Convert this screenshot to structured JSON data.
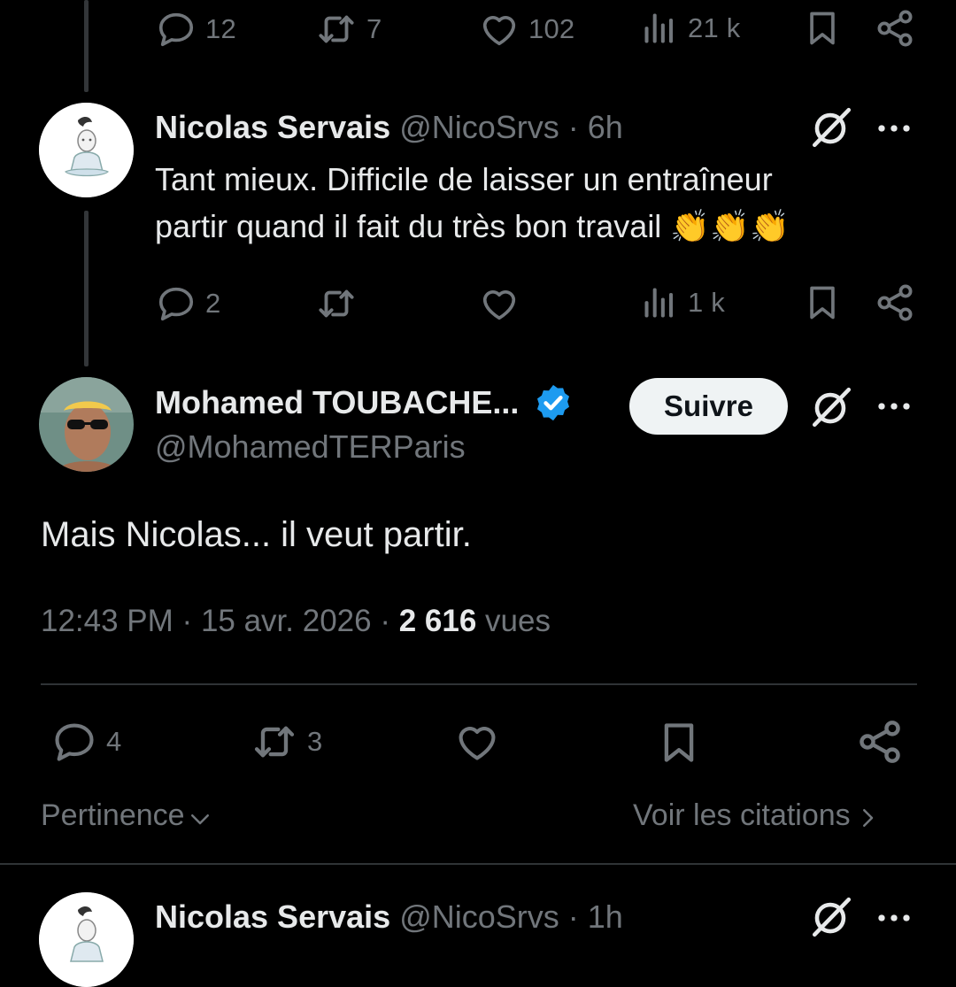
{
  "top_tweet_actions": {
    "replies": "12",
    "reposts": "7",
    "likes": "102",
    "views": "21 k"
  },
  "reply1": {
    "author_name": "Nicolas Servais",
    "handle": "@NicoSrvs",
    "separator": "·",
    "time": "6h",
    "text_line1": "Tant mieux. Difficile de laisser un entraîneur",
    "text_line2": "partir quand il fait du très bon travail",
    "emojis": "👏👏👏",
    "actions": {
      "replies": "2",
      "reposts": "",
      "likes": "",
      "views": "1 k"
    }
  },
  "main_tweet": {
    "author_name": "Mohamed TOUBACHE...",
    "handle": "@MohamedTERParis",
    "follow_label": "Suivre",
    "verified_color": "#1d9bf0",
    "text": "Mais Nicolas... il veut partir.",
    "time": "12:43 PM",
    "date": "15 avr. 2026",
    "dot": "·",
    "views_count": "2 616",
    "views_label": "vues",
    "actions": {
      "replies": "4",
      "reposts": "3"
    }
  },
  "sort": {
    "label": "Pertinence",
    "quotes_label": "Voir les citations"
  },
  "reply2": {
    "author_name": "Nicolas Servais",
    "handle": "@NicoSrvs",
    "separator": "·",
    "time": "1h"
  },
  "colors": {
    "background": "#000000",
    "text_primary": "#e7e9ea",
    "text_secondary": "#71767b",
    "divider": "#2f3336",
    "verified": "#1d9bf0"
  },
  "icons": [
    "reply-icon",
    "repost-icon",
    "like-icon",
    "views-icon",
    "bookmark-icon",
    "share-icon",
    "grok-icon",
    "more-icon",
    "verified-badge-icon",
    "chevron-down-icon",
    "chevron-right-icon"
  ]
}
